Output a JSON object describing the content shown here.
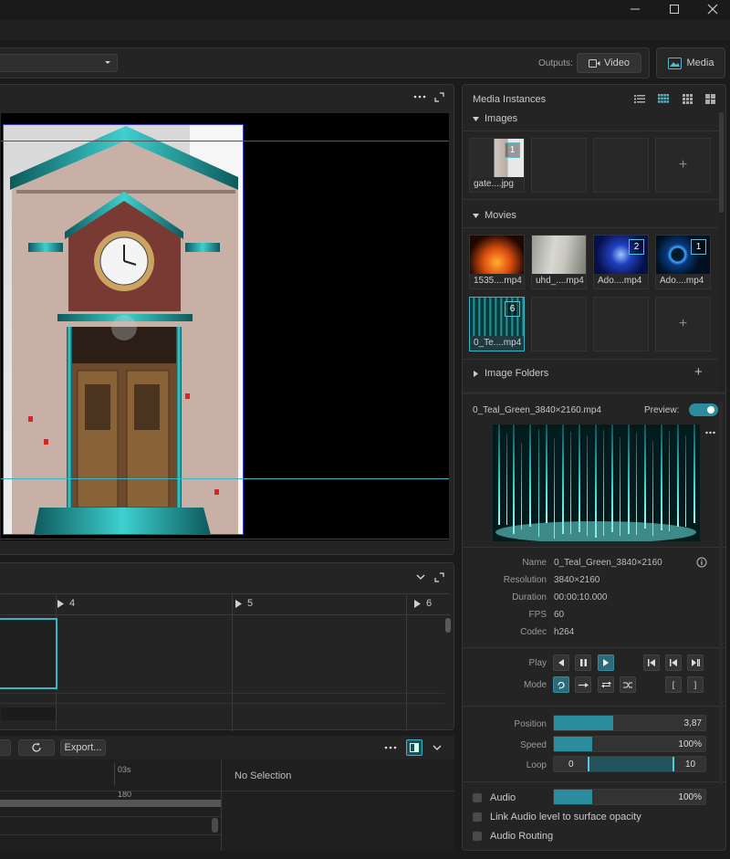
{
  "window": {
    "minimize_icon": "minimize-icon",
    "maximize_icon": "maximize-icon",
    "close_icon": "close-icon"
  },
  "toolbar": {
    "outputs_label": "Outputs:",
    "video_label": "Video",
    "media_label": "Media"
  },
  "layers": {
    "columns": [
      "4",
      "5",
      "6"
    ]
  },
  "bottom_bar": {
    "export_label": "Export...",
    "time_label": "03s",
    "frame_label": "180",
    "no_selection": "No Selection"
  },
  "media_panel": {
    "title": "Media Instances",
    "images_section": "Images",
    "images": [
      {
        "name": "gate....jpg",
        "badge": "1"
      }
    ],
    "movies_section": "Movies",
    "movies": [
      {
        "name": "1535....mp4",
        "badge": ""
      },
      {
        "name": "uhd_....mp4",
        "badge": ""
      },
      {
        "name": "Ado....mp4",
        "badge": "2"
      },
      {
        "name": "Ado....mp4",
        "badge": "1"
      },
      {
        "name": "0_Te....mp4",
        "badge": "6"
      }
    ],
    "image_folders_section": "Image Folders"
  },
  "preview": {
    "filename": "0_Teal_Green_3840×2160.mp4",
    "preview_label": "Preview:",
    "preview_on": true
  },
  "info": {
    "rows": [
      {
        "label": "Name",
        "value": "0_Teal_Green_3840×2160"
      },
      {
        "label": "Resolution",
        "value": "3840×2160"
      },
      {
        "label": "Duration",
        "value": "00:00:10.000"
      },
      {
        "label": "FPS",
        "value": "60"
      },
      {
        "label": "Codec",
        "value": "h264"
      }
    ]
  },
  "playback": {
    "play_label": "Play",
    "mode_label": "Mode",
    "bracket_open": "[",
    "bracket_close": "]"
  },
  "params": {
    "position_label": "Position",
    "position_value": "3,87",
    "position_fraction": 0.39,
    "speed_label": "Speed",
    "speed_value": "100%",
    "speed_fraction": 0.25,
    "loop_label": "Loop",
    "loop_min": "0",
    "loop_max": "10"
  },
  "audio": {
    "audio_label": "Audio",
    "audio_value": "100%",
    "audio_fraction": 0.25,
    "link_label": "Link Audio level to surface opacity",
    "routing_label": "Audio Routing"
  },
  "colors": {
    "accent": "#2a8c9c",
    "background": "#1b1b1b",
    "panel": "#242424"
  }
}
